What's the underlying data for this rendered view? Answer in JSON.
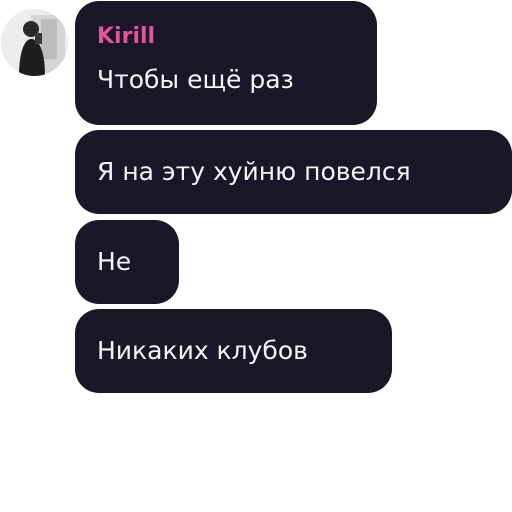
{
  "sender": {
    "name": "Kirill",
    "name_color": "#e0569a",
    "avatar_icon": "user-photo-avatar"
  },
  "theme": {
    "bubble_color": "#1b1728",
    "text_color": "#f5f5f5",
    "background": "#ffffff"
  },
  "messages": [
    {
      "text": "Чтобы ещё раз"
    },
    {
      "text": "Я на эту хуйню повелся"
    },
    {
      "text": "Не"
    },
    {
      "text": "Никаких клубов"
    }
  ]
}
